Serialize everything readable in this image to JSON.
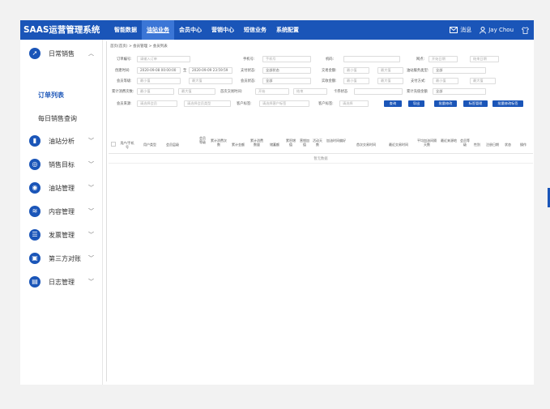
{
  "topbar": {
    "brand": "SAAS运营管理系统",
    "nav": [
      "智能数据",
      "油站业务",
      "会员中心",
      "营销中心",
      "短信业务",
      "系统配置"
    ],
    "nav_active_index": 1,
    "messages_label": "消息",
    "user_name": "Jay Chou"
  },
  "sidebar": {
    "menus": [
      {
        "label": "日常销售",
        "icon": "sales-icon",
        "expanded": true
      },
      {
        "label": "油站分析",
        "icon": "bar-chart-icon"
      },
      {
        "label": "销售目标",
        "icon": "target-icon"
      },
      {
        "label": "油站管理",
        "icon": "eye-icon"
      },
      {
        "label": "内容管理",
        "icon": "layers-icon"
      },
      {
        "label": "发票管理",
        "icon": "invoice-icon"
      },
      {
        "label": "第三方对账",
        "icon": "reconcile-icon"
      },
      {
        "label": "日志管理",
        "icon": "log-icon"
      }
    ],
    "submenu": [
      "订单列表",
      "每日销售查询"
    ],
    "submenu_active_index": 0
  },
  "content": {
    "breadcrumb": "首页(首页) > 会员管理 > 会员列表",
    "filters": {
      "r1": [
        "订单编号:",
        "请输入订单",
        "手机号:",
        "手机号",
        "机码:",
        "",
        "网点:",
        "开始日期",
        "结束日期"
      ],
      "r2": [
        "创建时间:",
        "2020-09-08 00:00:00",
        "至",
        "2020-09-09 23:59:59",
        "支付状态:",
        "全部状态",
        "交易金额:",
        "最小值",
        "最大值",
        "油站服务类型:",
        "全部"
      ],
      "r3": [
        "会员等级:",
        "最小值",
        "最大值",
        "会员状态:",
        "全部",
        "实收金额:",
        "最小值",
        "最大值",
        "支付方式:",
        "最小值",
        "最大值"
      ],
      "r4": [
        "累计消费次数:",
        "最小值",
        "最大值",
        "首次交易时间:",
        "开始",
        "结束",
        "卡券状态",
        "",
        "累计充值金额",
        "全部"
      ],
      "r5": [
        "会员来源:",
        "请选择会员",
        "请选择会员类型",
        "客户标签:",
        "请选择客户标签",
        "客户标签:",
        "请选择"
      ],
      "buttons": [
        "查询",
        "导出",
        "批量修改",
        "标签管理",
        "批量修改标签"
      ]
    },
    "table": {
      "headers": [
        "用户/手机号",
        "用户类型",
        "会员层级",
        "会员等级",
        "累计消费次数",
        "累计金额",
        "累计消费数量",
        "储蓄额",
        "累积增值",
        "营销加值",
        "活动天数",
        "加油时间偏好",
        "首次交易时间",
        "最近交易时间",
        "平均加油间隔天数",
        "最近来源地",
        "会员等级",
        "性别",
        "注册日期",
        "状态",
        "操作"
      ],
      "empty_text": "暂无数据"
    }
  }
}
